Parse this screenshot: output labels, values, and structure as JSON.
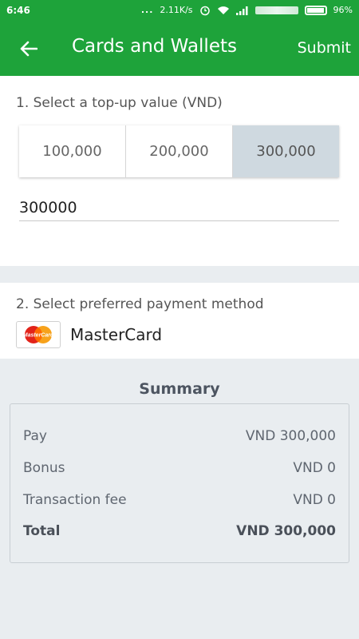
{
  "status_bar": {
    "time": "6:46",
    "dots": "...",
    "network_speed": "2.11K/s",
    "battery": "96%"
  },
  "toolbar": {
    "title": "Cards and Wallets",
    "submit_label": "Submit",
    "bg_color": "#1ea33a"
  },
  "topup": {
    "label": "1. Select a top-up value (VND)",
    "options": [
      "100,000",
      "200,000",
      "300,000"
    ],
    "selected_index": 2,
    "amount_value": "300000"
  },
  "payment": {
    "label": "2. Select preferred payment method",
    "method_name": "MasterCard",
    "logo_text": "MasterCard"
  },
  "summary": {
    "title": "Summary",
    "rows": [
      {
        "label": "Pay",
        "value": "VND 300,000"
      },
      {
        "label": "Bonus",
        "value": "VND 0"
      },
      {
        "label": "Transaction fee",
        "value": "VND 0"
      },
      {
        "label": "Total",
        "value": "VND 300,000"
      }
    ]
  }
}
